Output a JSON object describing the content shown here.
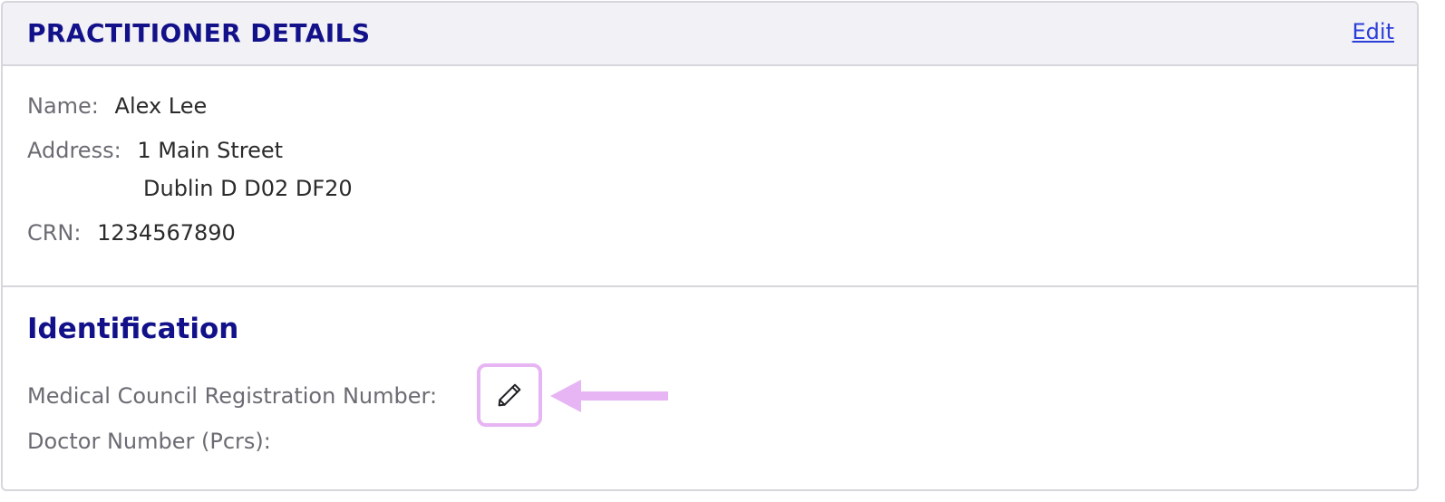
{
  "header": {
    "title": "PRACTITIONER DETAILS",
    "edit_label": "Edit"
  },
  "details": {
    "name_label": "Name:",
    "name_value": "Alex Lee",
    "address_label": "Address:",
    "address_line1": "1 Main Street",
    "address_line2": "Dublin D D02 DF20",
    "crn_label": "CRN:",
    "crn_value": "1234567890"
  },
  "identification": {
    "title": "Identification",
    "mcrn_label": "Medical Council Registration Number:",
    "doctor_number_label": "Doctor Number (Pcrs):"
  },
  "icons": {
    "edit": "pencil-icon",
    "annotation": "arrow-left-icon"
  },
  "colors": {
    "header_text": "#12118a",
    "link": "#2c3fd9",
    "highlight": "#e7b5f3"
  }
}
